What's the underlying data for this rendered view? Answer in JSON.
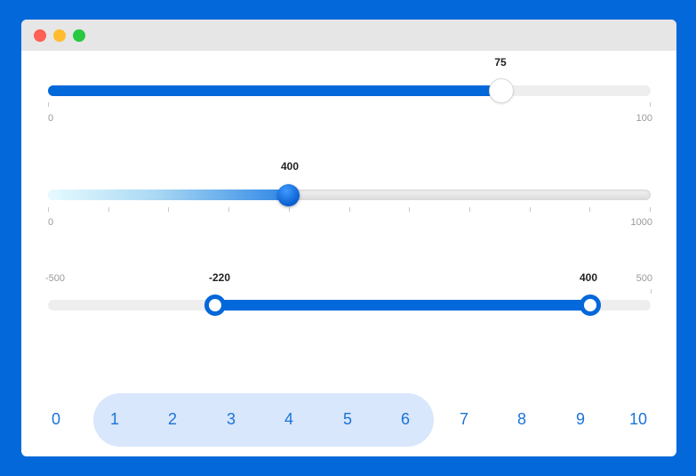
{
  "window": {
    "controls": [
      "close",
      "minimize",
      "maximize"
    ]
  },
  "slider_basic": {
    "value": "75",
    "min": "0",
    "max": "100",
    "fill_fraction": 0.75,
    "color": "#0368d9"
  },
  "slider_stepped": {
    "value": "400",
    "min": "0",
    "max": "1000",
    "fill_fraction": 0.4,
    "tick_count": 11
  },
  "slider_range": {
    "low": "-220",
    "high": "400",
    "min": "-500",
    "max": "500",
    "color": "#0368d9"
  },
  "number_picker": {
    "options": [
      "0",
      "1",
      "2",
      "3",
      "4",
      "5",
      "6",
      "7",
      "8",
      "9",
      "10"
    ],
    "selected_start": "1",
    "selected_end": "6",
    "highlight_color": "#d8e7fb",
    "text_color": "#1a73d9"
  },
  "colors": {
    "background": "#0368d9",
    "window": "#ffffff",
    "titlebar": "#e6e6e6"
  }
}
